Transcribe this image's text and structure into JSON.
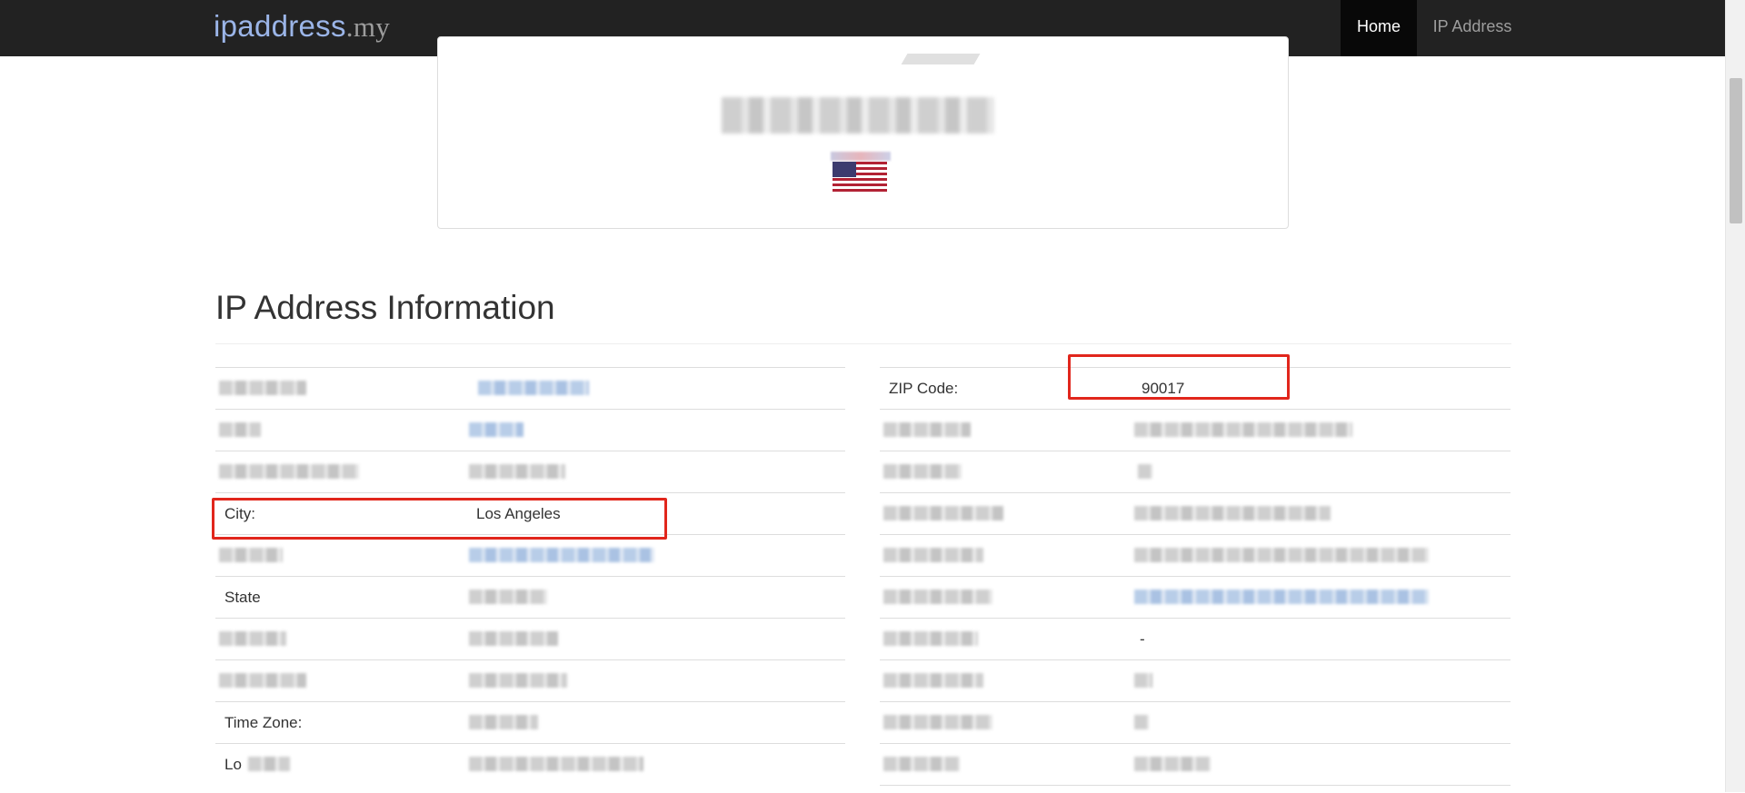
{
  "nav": {
    "brand_main": "ipaddress",
    "brand_tld": ".my",
    "home_label": "Home",
    "ip_label": "IP Address"
  },
  "card": {
    "flag_icon": "us-flag-icon"
  },
  "section": {
    "title": "IP Address Information"
  },
  "left_rows": [
    {
      "label": "",
      "value": ""
    },
    {
      "label": "",
      "value": ""
    },
    {
      "label": "",
      "value": ""
    },
    {
      "label": "City:",
      "value": "Los Angeles"
    },
    {
      "label": "",
      "value": ""
    },
    {
      "label": "State",
      "value": ""
    },
    {
      "label": "",
      "value": ""
    },
    {
      "label": "",
      "value": ""
    },
    {
      "label": "Time Zone:",
      "value": ""
    },
    {
      "label": "Lo",
      "value": ""
    }
  ],
  "right_rows": [
    {
      "label": "ZIP Code:",
      "value": "90017"
    },
    {
      "label": "",
      "value": ""
    },
    {
      "label": "",
      "value": ""
    },
    {
      "label": "",
      "value": ""
    },
    {
      "label": "",
      "value": ""
    },
    {
      "label": "",
      "value": ""
    },
    {
      "label": "",
      "value": "-"
    },
    {
      "label": "",
      "value": ""
    },
    {
      "label": "",
      "value": ""
    },
    {
      "label": "",
      "value": ""
    }
  ],
  "colors": {
    "navbar": "#222222",
    "highlight": "#e1261c",
    "link": "#428bca"
  }
}
